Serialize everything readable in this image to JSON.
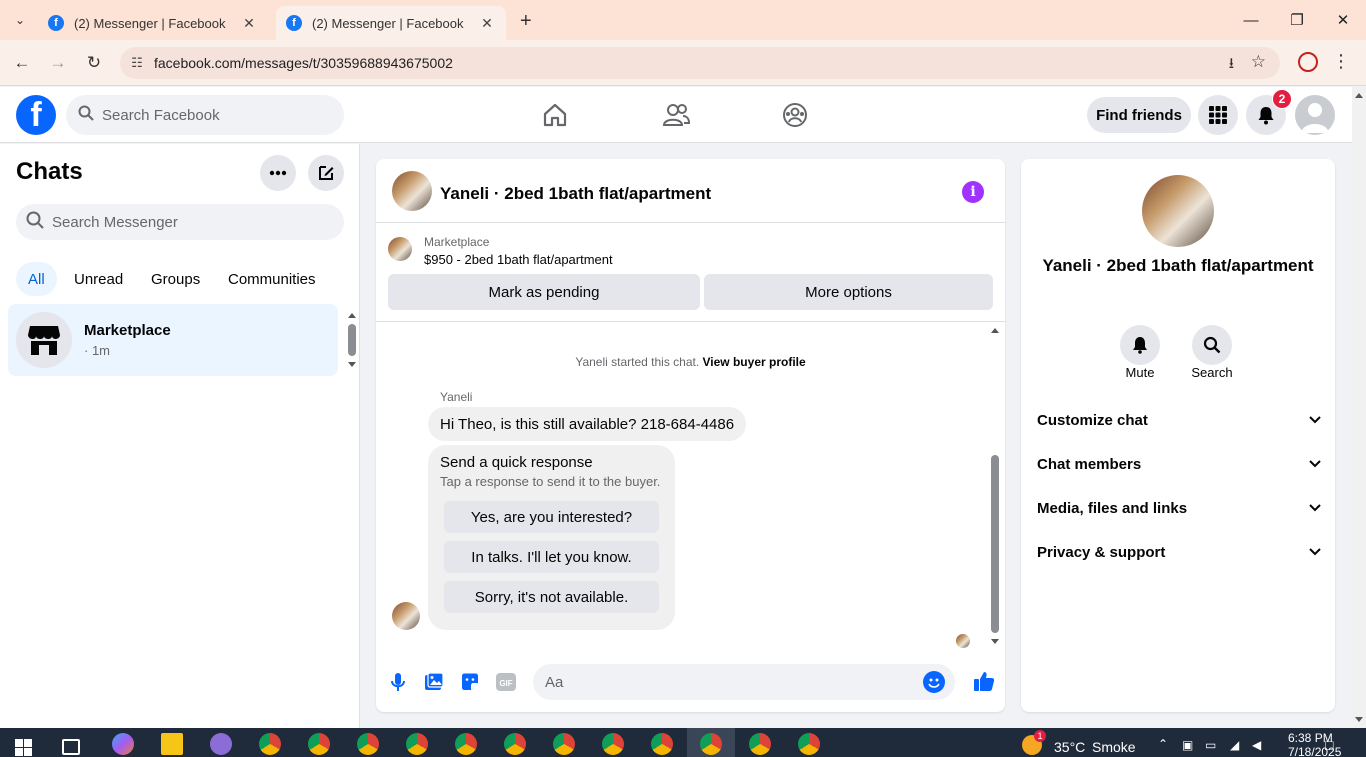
{
  "browser": {
    "tabs": [
      {
        "title": "(2) Messenger | Facebook",
        "active": false
      },
      {
        "title": "(2) Messenger | Facebook",
        "active": true
      }
    ],
    "url": "facebook.com/messages/t/30359688943675002"
  },
  "fb_header": {
    "search_placeholder": "Search Facebook",
    "find_friends": "Find friends",
    "notification_count": "2"
  },
  "chats": {
    "title": "Chats",
    "search_placeholder": "Search Messenger",
    "filters": [
      "All",
      "Unread",
      "Groups",
      "Communities"
    ],
    "items": [
      {
        "name": "Marketplace",
        "time": "· 1m"
      }
    ]
  },
  "conversation": {
    "title": "Yaneli · 2bed 1bath flat/apartment",
    "marketplace_label": "Marketplace",
    "listing": "$950 - 2bed 1bath flat/apartment",
    "mark_pending": "Mark as pending",
    "more_options": "More options",
    "system_message": "Yaneli started this chat.",
    "view_buyer_profile": "View buyer profile",
    "sender": "Yaneli",
    "message": "Hi Theo, is this still available? 218-684-4486",
    "quick_response_title": "Send a quick response",
    "quick_response_subtitle": "Tap a response to send it to the buyer.",
    "quick_responses": [
      "Yes, are you interested?",
      "In talks. I'll let you know.",
      "Sorry, it's not available."
    ],
    "composer_placeholder": "Aa"
  },
  "details": {
    "name": "Yaneli · 2bed 1bath flat/apartment",
    "actions": [
      "Mute",
      "Search"
    ],
    "sections": [
      "Customize chat",
      "Chat members",
      "Media, files and links",
      "Privacy & support"
    ]
  },
  "taskbar": {
    "weather_temp": "35°C",
    "weather_desc": "Smoke",
    "time": "6:38 PM",
    "date": "7/18/2025",
    "weather_alert": "1"
  },
  "colors": {
    "facebook_blue": "#0866ff",
    "accent_purple": "#a033ff",
    "selected_bg": "#ebf5ff",
    "badge_red": "#e41e3f"
  }
}
